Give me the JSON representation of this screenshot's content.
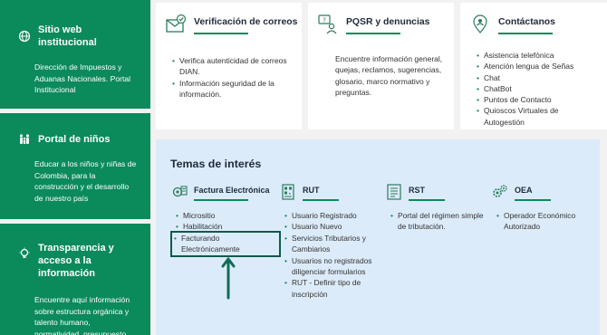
{
  "sidebar": {
    "panels": [
      {
        "title": "Sitio web institucional",
        "icon": "globe-icon",
        "desc": "Dirección de Impuestos y Aduanas Nacionales. Portal Institucional"
      },
      {
        "title": "Portal de niños",
        "icon": "family-icon",
        "desc": "Educar a los niños y niñas de Colombia, para la construcción y el desarrollo de nuestro país"
      },
      {
        "title": "Transparencia y acceso a la información",
        "icon": "lightbulb-icon",
        "desc": "Encuentre aquí información sobre estructura orgánica y talento humano, normatividad, presupuesto"
      }
    ]
  },
  "cards": [
    {
      "title": "Verificación de correos",
      "icon": "envelope-check-icon",
      "items": [
        "Verifica autenticidad de correos DIAN.",
        "Información seguridad de la información."
      ]
    },
    {
      "title": "PQSR y denuncias",
      "icon": "chat-help-icon",
      "text": "Encuentre información general, quejas, reclamos, sugerencias, glosario, marco normativo y preguntas."
    },
    {
      "title": "Contáctanos",
      "icon": "location-person-icon",
      "items": [
        "Asistencia telefónica",
        "Atención lengua de Señas",
        "Chat",
        "ChatBot",
        "Puntos de Contacto",
        "Quioscos Virtuales de Autogestión"
      ]
    }
  ],
  "temas": {
    "title": "Temas de interés",
    "topics": [
      {
        "title": "Factura Electrónica",
        "icon": "invoice-gear-icon",
        "items": [
          "Micrositio",
          "Habilitación",
          "Facturando Electrónicamente"
        ]
      },
      {
        "title": "RUT",
        "icon": "qr-document-icon",
        "items": [
          "Usuario Registrado",
          "Usuario Nuevo",
          "Servicios Tributarios y Cambiarios",
          "Usuarios no registrados diligenciar formularios",
          "RUT - Definir tipo de inscripción"
        ]
      },
      {
        "title": "RST",
        "icon": "document-list-icon",
        "items": [
          "Portal del régimen simple de tributación."
        ]
      },
      {
        "title": "OEA",
        "icon": "gears-icon",
        "items": [
          "Operador Económico Autorizado"
        ]
      }
    ]
  },
  "colors": {
    "green": "#0b8a5c",
    "highlight": "#0f5a4a",
    "panel_blue": "#dcebfa"
  }
}
